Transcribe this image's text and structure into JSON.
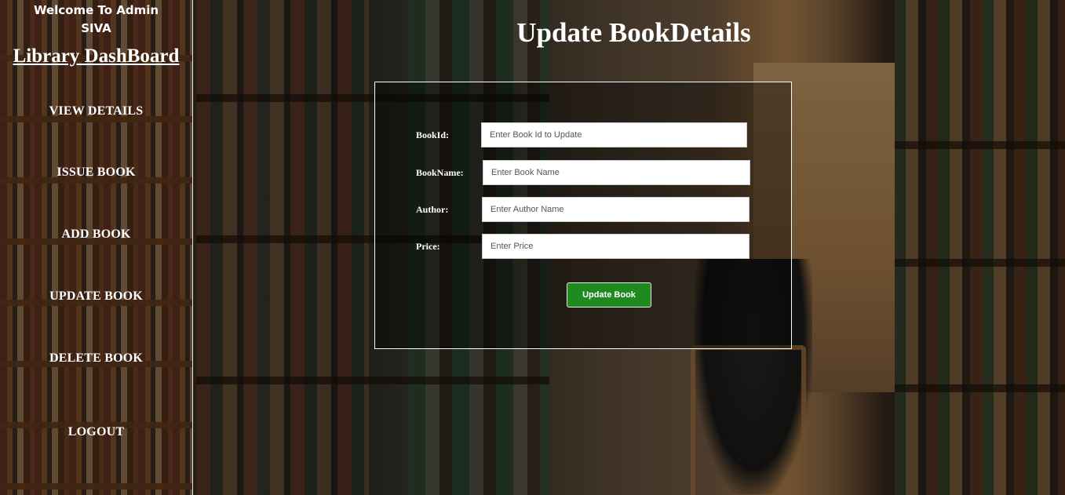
{
  "sidebar": {
    "welcome_line1": "Welcome To Admin",
    "welcome_line2": "SIVA",
    "dashboard_title": "Library DashBoard",
    "nav": {
      "view_details": "VIEW DETAILS",
      "issue_book": "ISSUE BOOK",
      "add_book": "ADD BOOK",
      "update_book": "UPDATE BOOK",
      "delete_book": "DELETE BOOK",
      "logout": "LOGOUT"
    }
  },
  "main": {
    "title": "Update BookDetails",
    "form": {
      "book_id": {
        "label": "BookId:",
        "placeholder": "Enter Book Id to Update",
        "value": ""
      },
      "book_name": {
        "label": "BookName:",
        "placeholder": "Enter Book Name",
        "value": ""
      },
      "author": {
        "label": "Author:",
        "placeholder": "Enter Author Name",
        "value": ""
      },
      "price": {
        "label": "Price:",
        "placeholder": "Enter Price",
        "value": ""
      },
      "submit_label": "Update Book"
    }
  },
  "colors": {
    "submit_button": "#1f8a1f",
    "text": "#ffffff",
    "form_border": "#ffffff"
  }
}
